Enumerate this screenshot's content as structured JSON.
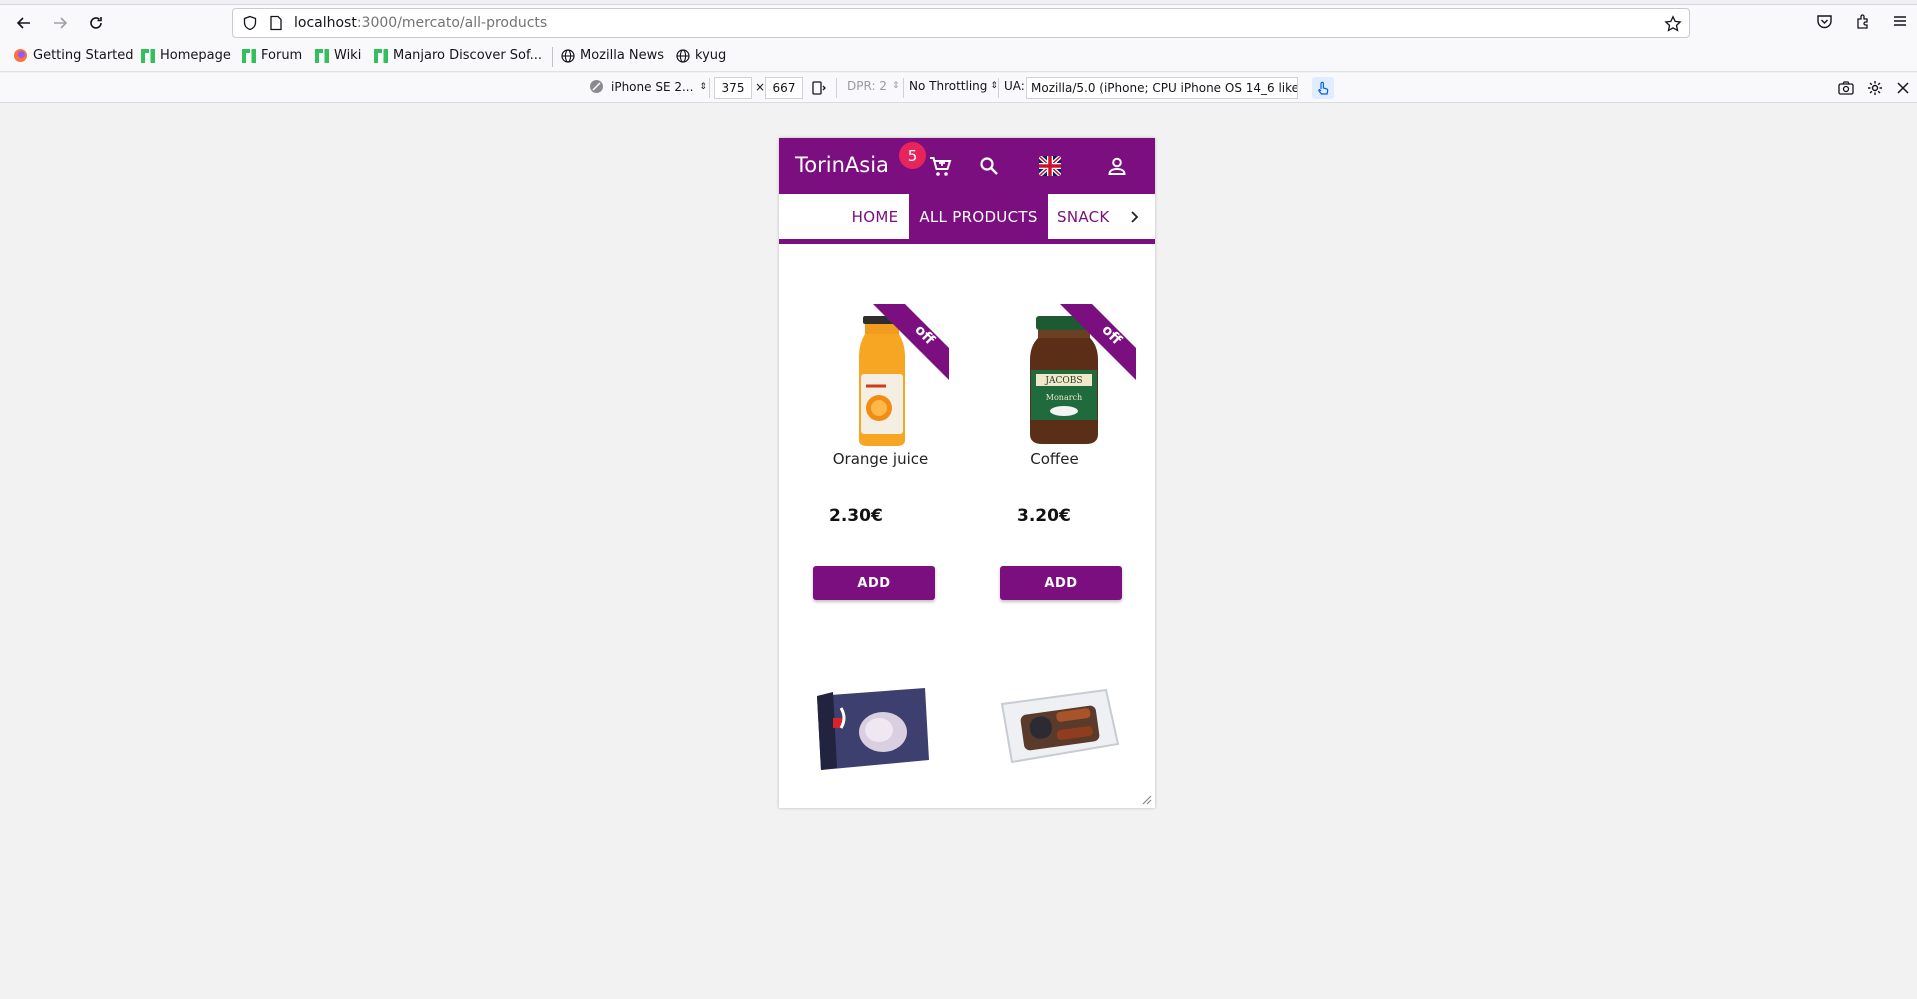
{
  "browser": {
    "url_host": "localhost",
    "url_path": ":3000/mercato/all-products",
    "bookmarks": [
      {
        "label": "Getting Started",
        "icon": "firefox-icon"
      },
      {
        "label": "Homepage",
        "icon": "manjaro-icon"
      },
      {
        "label": "Forum",
        "icon": "manjaro-icon"
      },
      {
        "label": "Wiki",
        "icon": "manjaro-icon"
      },
      {
        "label": "Manjaro Discover Sof...",
        "icon": "manjaro-icon"
      },
      {
        "label": "Mozilla News",
        "icon": "globe-icon"
      },
      {
        "label": "kyug",
        "icon": "globe-icon"
      }
    ]
  },
  "rdm": {
    "device": "iPhone SE 2...",
    "width": "375",
    "times": "×",
    "height": "667",
    "dpr": "DPR: 2",
    "throttling": "No Throttling",
    "ua_label": "UA:",
    "ua_value": "Mozilla/5.0 (iPhone; CPU iPhone OS 14_6 like M"
  },
  "app": {
    "brand": "TorinAsia",
    "cart_count": "5",
    "tabs": [
      {
        "label": "HOME",
        "active": false
      },
      {
        "label": "ALL PRODUCTS",
        "active": true
      },
      {
        "label": "SNACK",
        "active": false
      }
    ],
    "products": [
      {
        "name": "Orange juice",
        "price": "2.30€",
        "badge": "off",
        "add_label": "ADD"
      },
      {
        "name": "Coffee",
        "price": "3.20€",
        "badge": "off",
        "add_label": "ADD"
      },
      {
        "name": "",
        "price": "",
        "badge": "",
        "add_label": ""
      },
      {
        "name": "",
        "price": "",
        "badge": "",
        "add_label": ""
      }
    ]
  },
  "colors": {
    "brand": "#7b0f80",
    "badge": "#e8245c"
  }
}
